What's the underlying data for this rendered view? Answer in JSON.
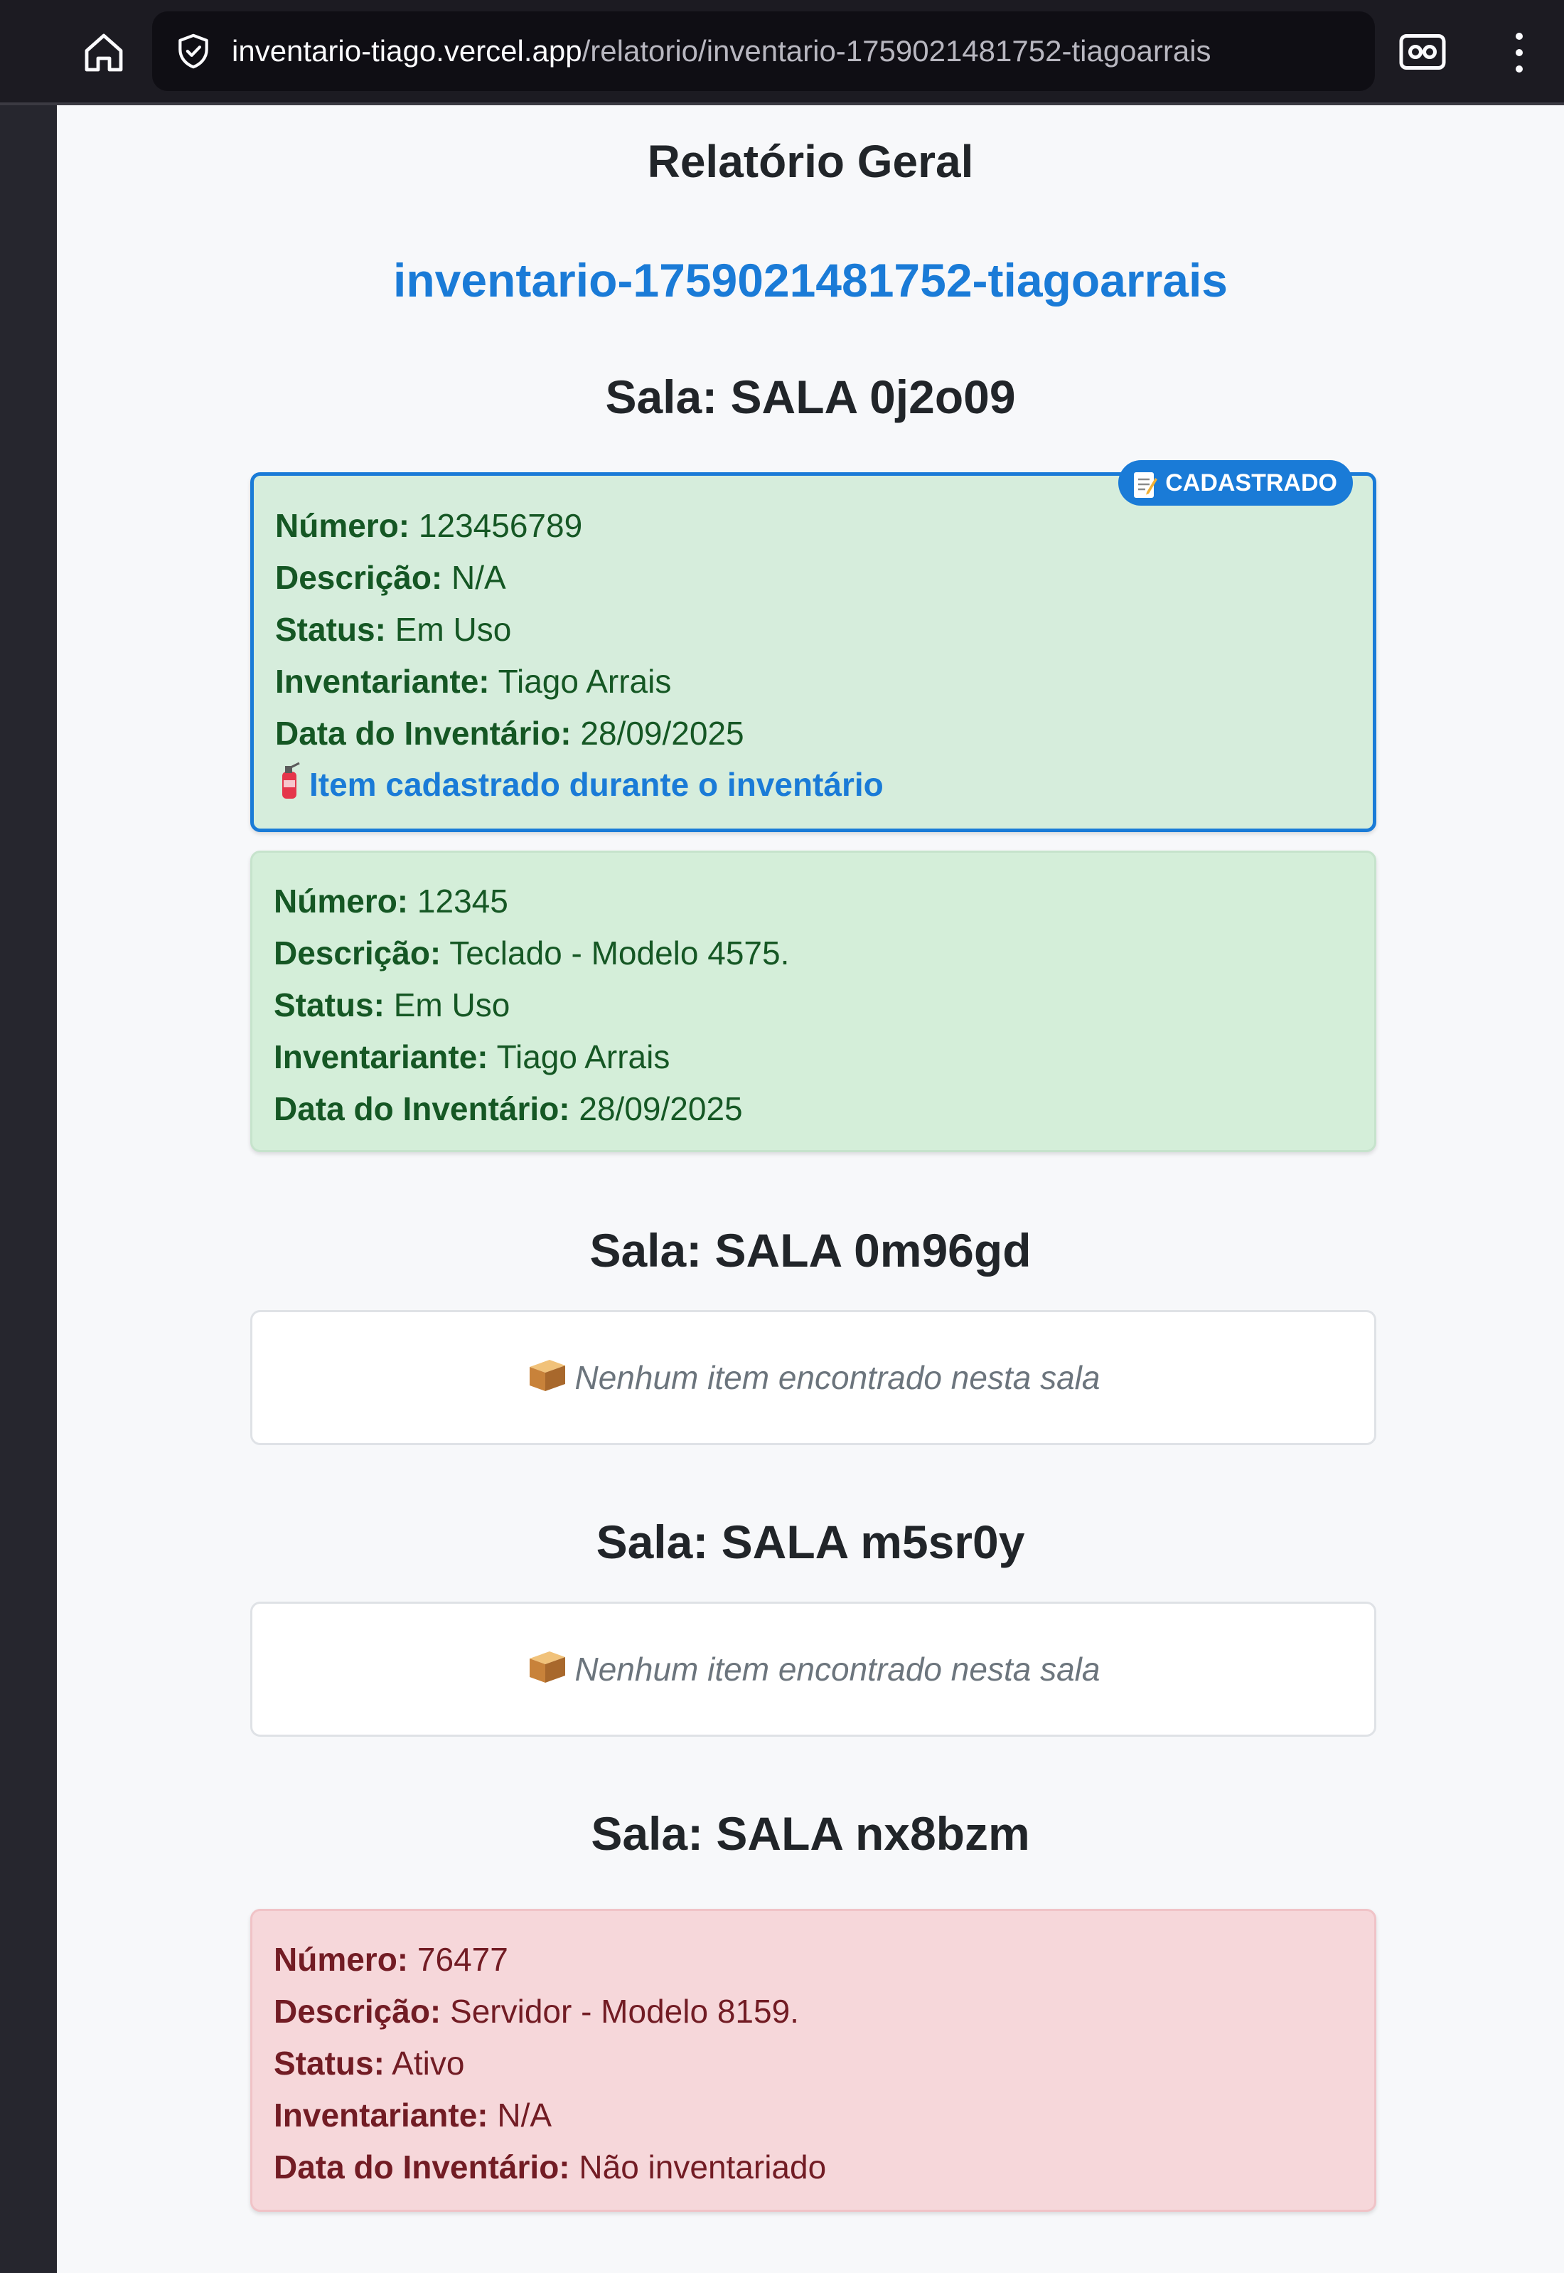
{
  "browser": {
    "url_host": "inventario-tiago.vercel.app",
    "url_path": "/relatorio/inventario-1759021481752-tiagoarrais"
  },
  "report": {
    "title": "Relatório Geral",
    "inventory_id": "inventario-1759021481752-tiagoarrais"
  },
  "labels": {
    "numero": "Número:",
    "descricao": "Descrição:",
    "status": "Status:",
    "inventariante": "Inventariante:",
    "data": "Data do Inventário:",
    "badge": "CADASTRADO",
    "new_item_note": "Item cadastrado durante o inventário",
    "empty": "Nenhum item encontrado nesta sala"
  },
  "rooms": [
    {
      "title": "Sala: SALA 0j2o09",
      "items": [
        {
          "numero": "123456789",
          "descricao": "N/A",
          "status": "Em Uso",
          "inventariante": "Tiago Arrais",
          "data": "28/09/2025",
          "cadastrado": true,
          "color": "#d4eed9"
        },
        {
          "numero": "12345",
          "descricao": "Teclado - Modelo 4575.",
          "status": "Em Uso",
          "inventariante": "Tiago Arrais",
          "data": "28/09/2025",
          "cadastrado": false,
          "color": "#d4eed9"
        }
      ]
    },
    {
      "title": "Sala: SALA 0m96gd",
      "items": []
    },
    {
      "title": "Sala: SALA m5sr0y",
      "items": []
    },
    {
      "title": "Sala: SALA nx8bzm",
      "items": [
        {
          "numero": "76477",
          "descricao": "Servidor - Modelo 8159.",
          "status": "Ativo",
          "inventariante": "N/A",
          "data": "Não inventariado",
          "cadastrado": false,
          "color": "#f6d7da"
        }
      ]
    }
  ],
  "colors": {
    "accent": "#1a7bd7",
    "found_bg": "#d4eed9",
    "missing_bg": "#f6d7da"
  }
}
